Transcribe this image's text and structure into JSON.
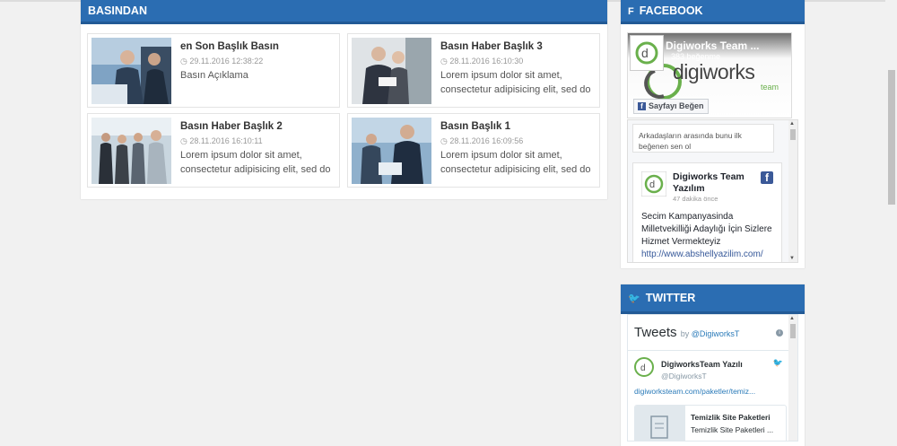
{
  "news": {
    "heading": "BASINDAN",
    "items": [
      {
        "title": "en Son Başlık Basın",
        "date": "29.11.2016 12:38:22",
        "text": "Basın Açıklama"
      },
      {
        "title": "Basın Haber Başlık 3",
        "date": "28.11.2016 16:10:30",
        "text": "Lorem ipsum dolor sit amet, consectetur adipisicing elit, sed do"
      },
      {
        "title": "Basın Haber Başlık 2",
        "date": "28.11.2016 16:10:11",
        "text": "Lorem ipsum dolor sit amet, consectetur adipisicing elit, sed do"
      },
      {
        "title": "Basın Başlık 1",
        "date": "28.11.2016 16:09:56",
        "text": "Lorem ipsum dolor sit amet, consectetur adipisicing elit, sed do"
      }
    ]
  },
  "facebook": {
    "heading": "FACEBOOK",
    "page_name": "Digiworks Team ...",
    "likes": "383 beğenme",
    "logo_word": "digiworks",
    "logo_team": "team",
    "like_button": "Sayfayı Beğen",
    "friends_text": "Arkadaşların arasında bunu ilk beğenen sen ol",
    "post": {
      "name": "Digiworks Team Yazılım",
      "time": "47 dakika önce",
      "text": "Secim Kampanyasinda Milletvekilliği Adaylığı İçin Sizlere Hizmet Vermekteyiz",
      "link": "http://www.abshellyazilim.com/"
    }
  },
  "twitter": {
    "heading": "TWITTER",
    "tweets_label": "Tweets",
    "by": "by",
    "handle": "@DigiworksT",
    "tweet_name": "DigiworksTeam Yazılı",
    "tweet_user": "@DigiworksT",
    "tweet_link": "digiworksteam.com/paketler/temiz...",
    "card_title": "Temizlik Site Paketleri",
    "card_desc": "Temizlik Site Paketleri ..."
  },
  "colors": {
    "header_blue": "#2b6db2",
    "fb_blue": "#3b5998",
    "logo_green": "#6ab04c"
  }
}
